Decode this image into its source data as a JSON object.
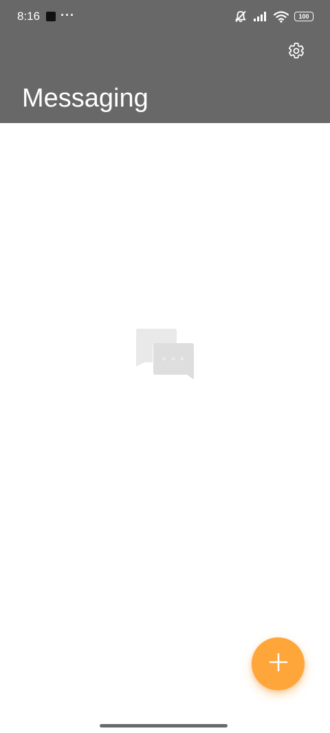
{
  "status_bar": {
    "time": "8:16",
    "more_indicator": "···",
    "battery_level": "100",
    "icons": [
      "notification-square-icon",
      "mute-icon",
      "signal-icon",
      "wifi-icon",
      "battery-icon"
    ]
  },
  "header": {
    "title": "Messaging",
    "background_color": "#686868",
    "settings_icon": "gear-icon"
  },
  "empty_state": {
    "icon": "chat-bubbles-icon"
  },
  "fab": {
    "icon": "plus-icon",
    "color": "#ffa63a"
  }
}
